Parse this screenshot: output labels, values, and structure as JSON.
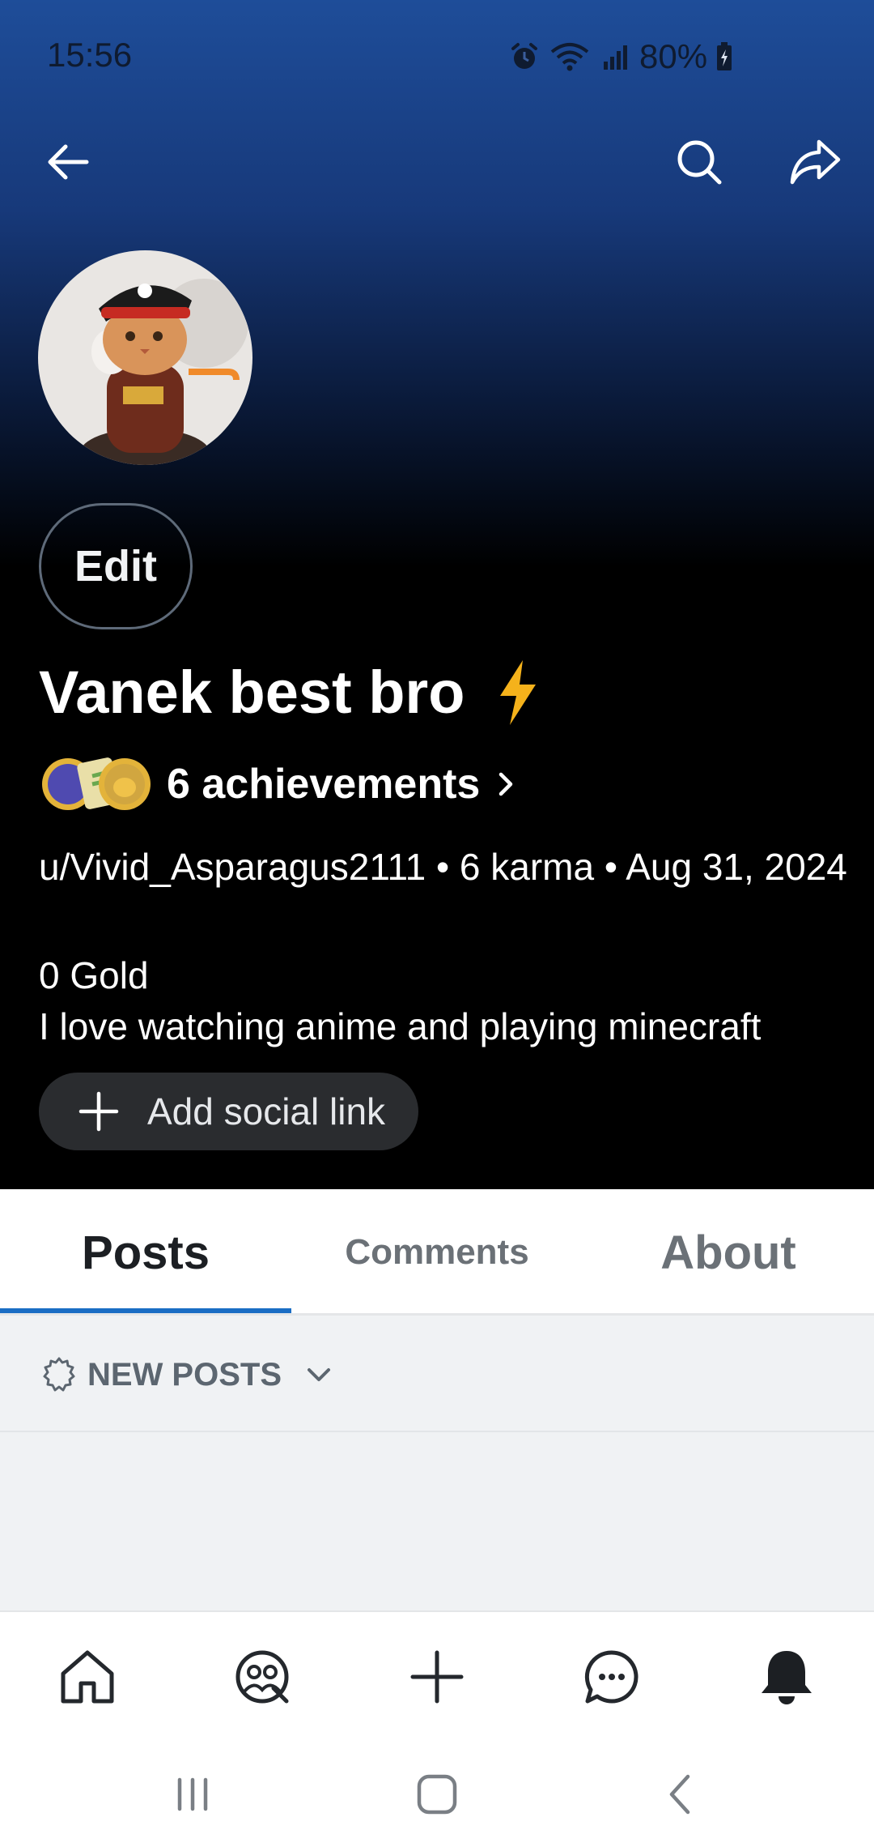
{
  "status_bar": {
    "time": "15:56",
    "battery": "80%"
  },
  "icons": {
    "back": "back-arrow-icon",
    "search": "search-icon",
    "share": "share-icon",
    "bolt": "lightning-bolt-icon",
    "chevron": "chevron-right-icon",
    "plus": "plus-icon",
    "sort": "gear-badge-icon",
    "dropdown": "chevron-down-icon"
  },
  "profile": {
    "edit_label": "Edit",
    "display_name": "Vanek best bro",
    "achievements": "6 achievements",
    "meta_line": "u/Vivid_Asparagus2111 • 6 karma • Aug 31, 2024",
    "gold": "0 Gold",
    "bio": "I love watching anime and playing minecraft",
    "social_link_label": "Add social link"
  },
  "tabs": [
    {
      "label": "Posts",
      "active": true
    },
    {
      "label": "Comments",
      "active": false
    },
    {
      "label": "About",
      "active": false
    }
  ],
  "feed": {
    "sort_label": "NEW POSTS"
  },
  "bottom_nav": [
    "home-icon",
    "communities-icon",
    "create-icon",
    "chat-icon",
    "notifications-bell-icon"
  ],
  "system_nav": [
    "recent-apps-icon",
    "home-button-icon",
    "system-back-icon"
  ],
  "colors": {
    "accent_blue": "#1a6dc4",
    "header_top": "#1e4d99",
    "bolt": "#f5b21b"
  }
}
